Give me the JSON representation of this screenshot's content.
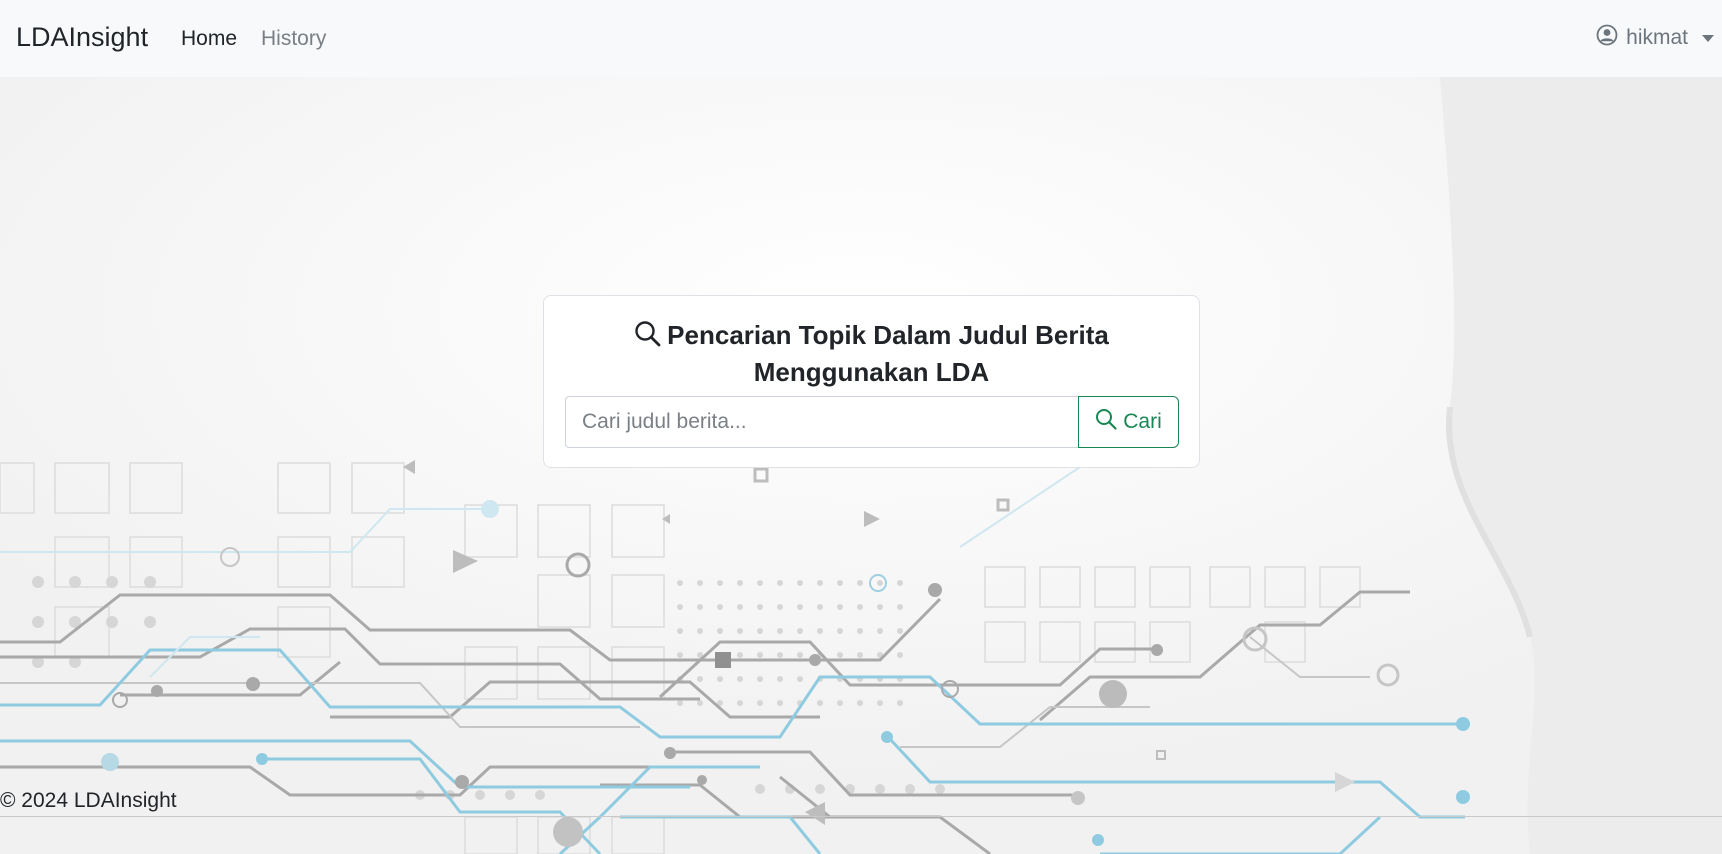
{
  "navbar": {
    "brand": "LDAInsight",
    "links": [
      {
        "label": "Home"
      },
      {
        "label": "History"
      }
    ],
    "user": {
      "name": "hikmat",
      "icon": "user-circle-icon"
    }
  },
  "search": {
    "title": "Pencarian Topik Dalam Judul Berita Menggunakan LDA",
    "title_icon": "search-icon",
    "placeholder": "Cari judul berita...",
    "value": "",
    "button_label": "Cari",
    "button_icon": "search-icon"
  },
  "footer": {
    "text": "© 2024 LDAInsight"
  },
  "colors": {
    "accent": "#198754",
    "circuit_blue": "#8fcbe0",
    "circuit_gray": "#a9a9a9"
  }
}
